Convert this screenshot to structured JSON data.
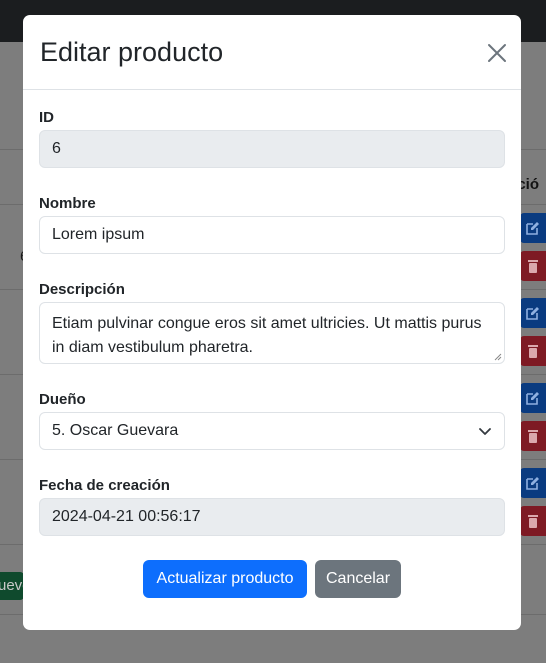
{
  "background": {
    "table_header_partial": "cció",
    "row_digit": "6",
    "new_button_partial": "ueve",
    "row_actions": [
      {
        "edit_icon": "edit-icon",
        "delete_icon": "trash-icon"
      },
      {
        "edit_icon": "edit-icon",
        "delete_icon": "trash-icon"
      },
      {
        "edit_icon": "edit-icon",
        "delete_icon": "trash-icon"
      },
      {
        "edit_icon": "edit-icon",
        "delete_icon": "trash-icon"
      }
    ]
  },
  "modal": {
    "title": "Editar producto",
    "close_icon": "close-icon",
    "fields": {
      "id": {
        "label": "ID",
        "value": "6"
      },
      "nombre": {
        "label": "Nombre",
        "value": "Lorem ipsum"
      },
      "descripcion": {
        "label": "Descripción",
        "value": "Etiam pulvinar congue eros sit amet ultricies. Ut mattis purus in diam vestibulum pharetra."
      },
      "dueno": {
        "label": "Dueño",
        "value": "5. Oscar Guevara"
      },
      "fecha": {
        "label": "Fecha de creación",
        "value": "2024-04-21 00:56:17"
      }
    },
    "buttons": {
      "submit": "Actualizar producto",
      "cancel": "Cancelar"
    }
  },
  "colors": {
    "primary": "#0d6efd",
    "secondary": "#6c757d",
    "disabled_field": "#e9ecef"
  }
}
